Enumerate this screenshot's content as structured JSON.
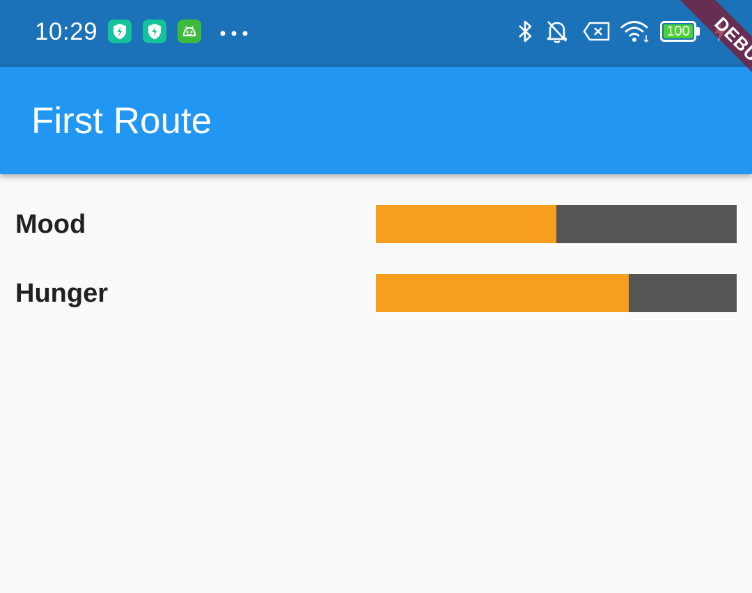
{
  "status_bar": {
    "time": "10:29",
    "battery_level": "100",
    "app_icons": [
      "shield-bolt-icon",
      "shield-bolt-icon",
      "android-robot-icon"
    ],
    "system_icons": [
      "bluetooth-icon",
      "bell-off-icon",
      "no-sim-icon",
      "wifi-icon",
      "battery-icon",
      "charging-icon"
    ],
    "colors": {
      "background": "#1B72B8",
      "app_icon_teal": "#14C39A",
      "app_icon_green": "#3DBB3D",
      "battery_fill": "#4CD137"
    }
  },
  "app_bar": {
    "title": "First Route",
    "color": "#2196F3"
  },
  "stats": [
    {
      "label": "Mood",
      "fraction": 0.5
    },
    {
      "label": "Hunger",
      "fraction": 0.7
    }
  ],
  "progress_colors": {
    "fill": "#F89E1F",
    "track": "#555555"
  },
  "debug_banner": {
    "text": "DEBUG"
  }
}
